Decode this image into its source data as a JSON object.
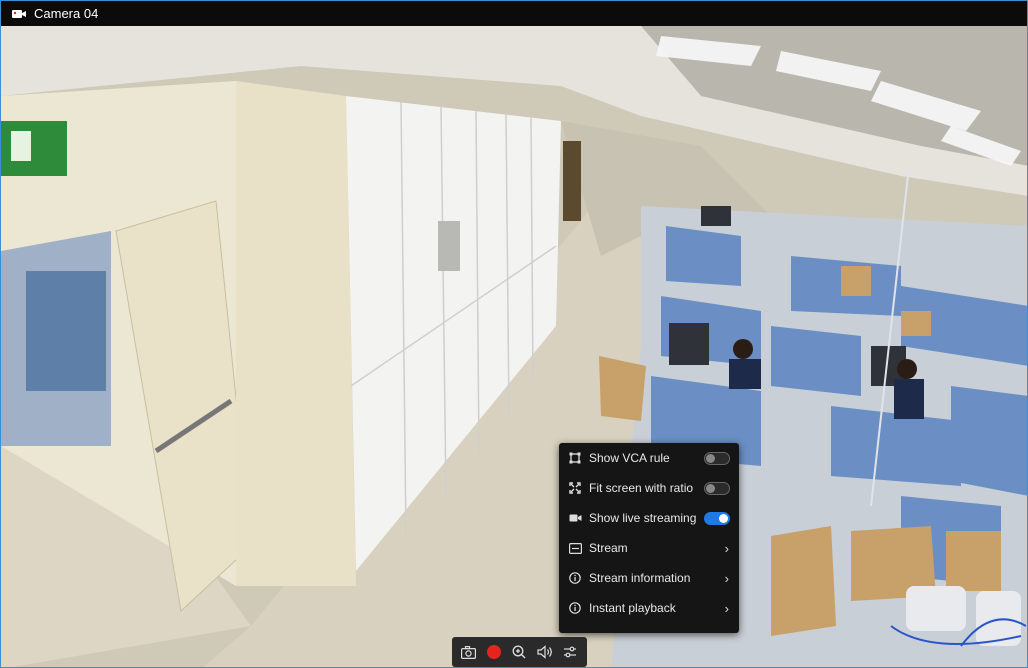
{
  "window": {
    "title": "Camera 04"
  },
  "menu": {
    "items": [
      {
        "label": "Show VCA rule",
        "icon": "vca-rule-icon",
        "control": "toggle",
        "state": "off"
      },
      {
        "label": "Fit screen with ratio",
        "icon": "fit-screen-icon",
        "control": "toggle",
        "state": "off"
      },
      {
        "label": "Show live streaming",
        "icon": "video-camera-icon",
        "control": "toggle",
        "state": "on"
      },
      {
        "label": "Stream",
        "icon": "stream-icon",
        "control": "submenu"
      },
      {
        "label": "Stream information",
        "icon": "info-icon",
        "control": "submenu"
      },
      {
        "label": "Instant playback",
        "icon": "info-icon",
        "control": "submenu"
      }
    ]
  },
  "toolbar": {
    "buttons": [
      "snapshot-icon",
      "record-icon",
      "zoom-in-icon",
      "volume-icon",
      "settings-sliders-icon"
    ]
  },
  "colors": {
    "accent": "#1e7be6",
    "record": "#e5241f",
    "menu_bg": "#151515",
    "titlebar_bg": "#0b0b0b",
    "border": "#3a8fd6"
  }
}
